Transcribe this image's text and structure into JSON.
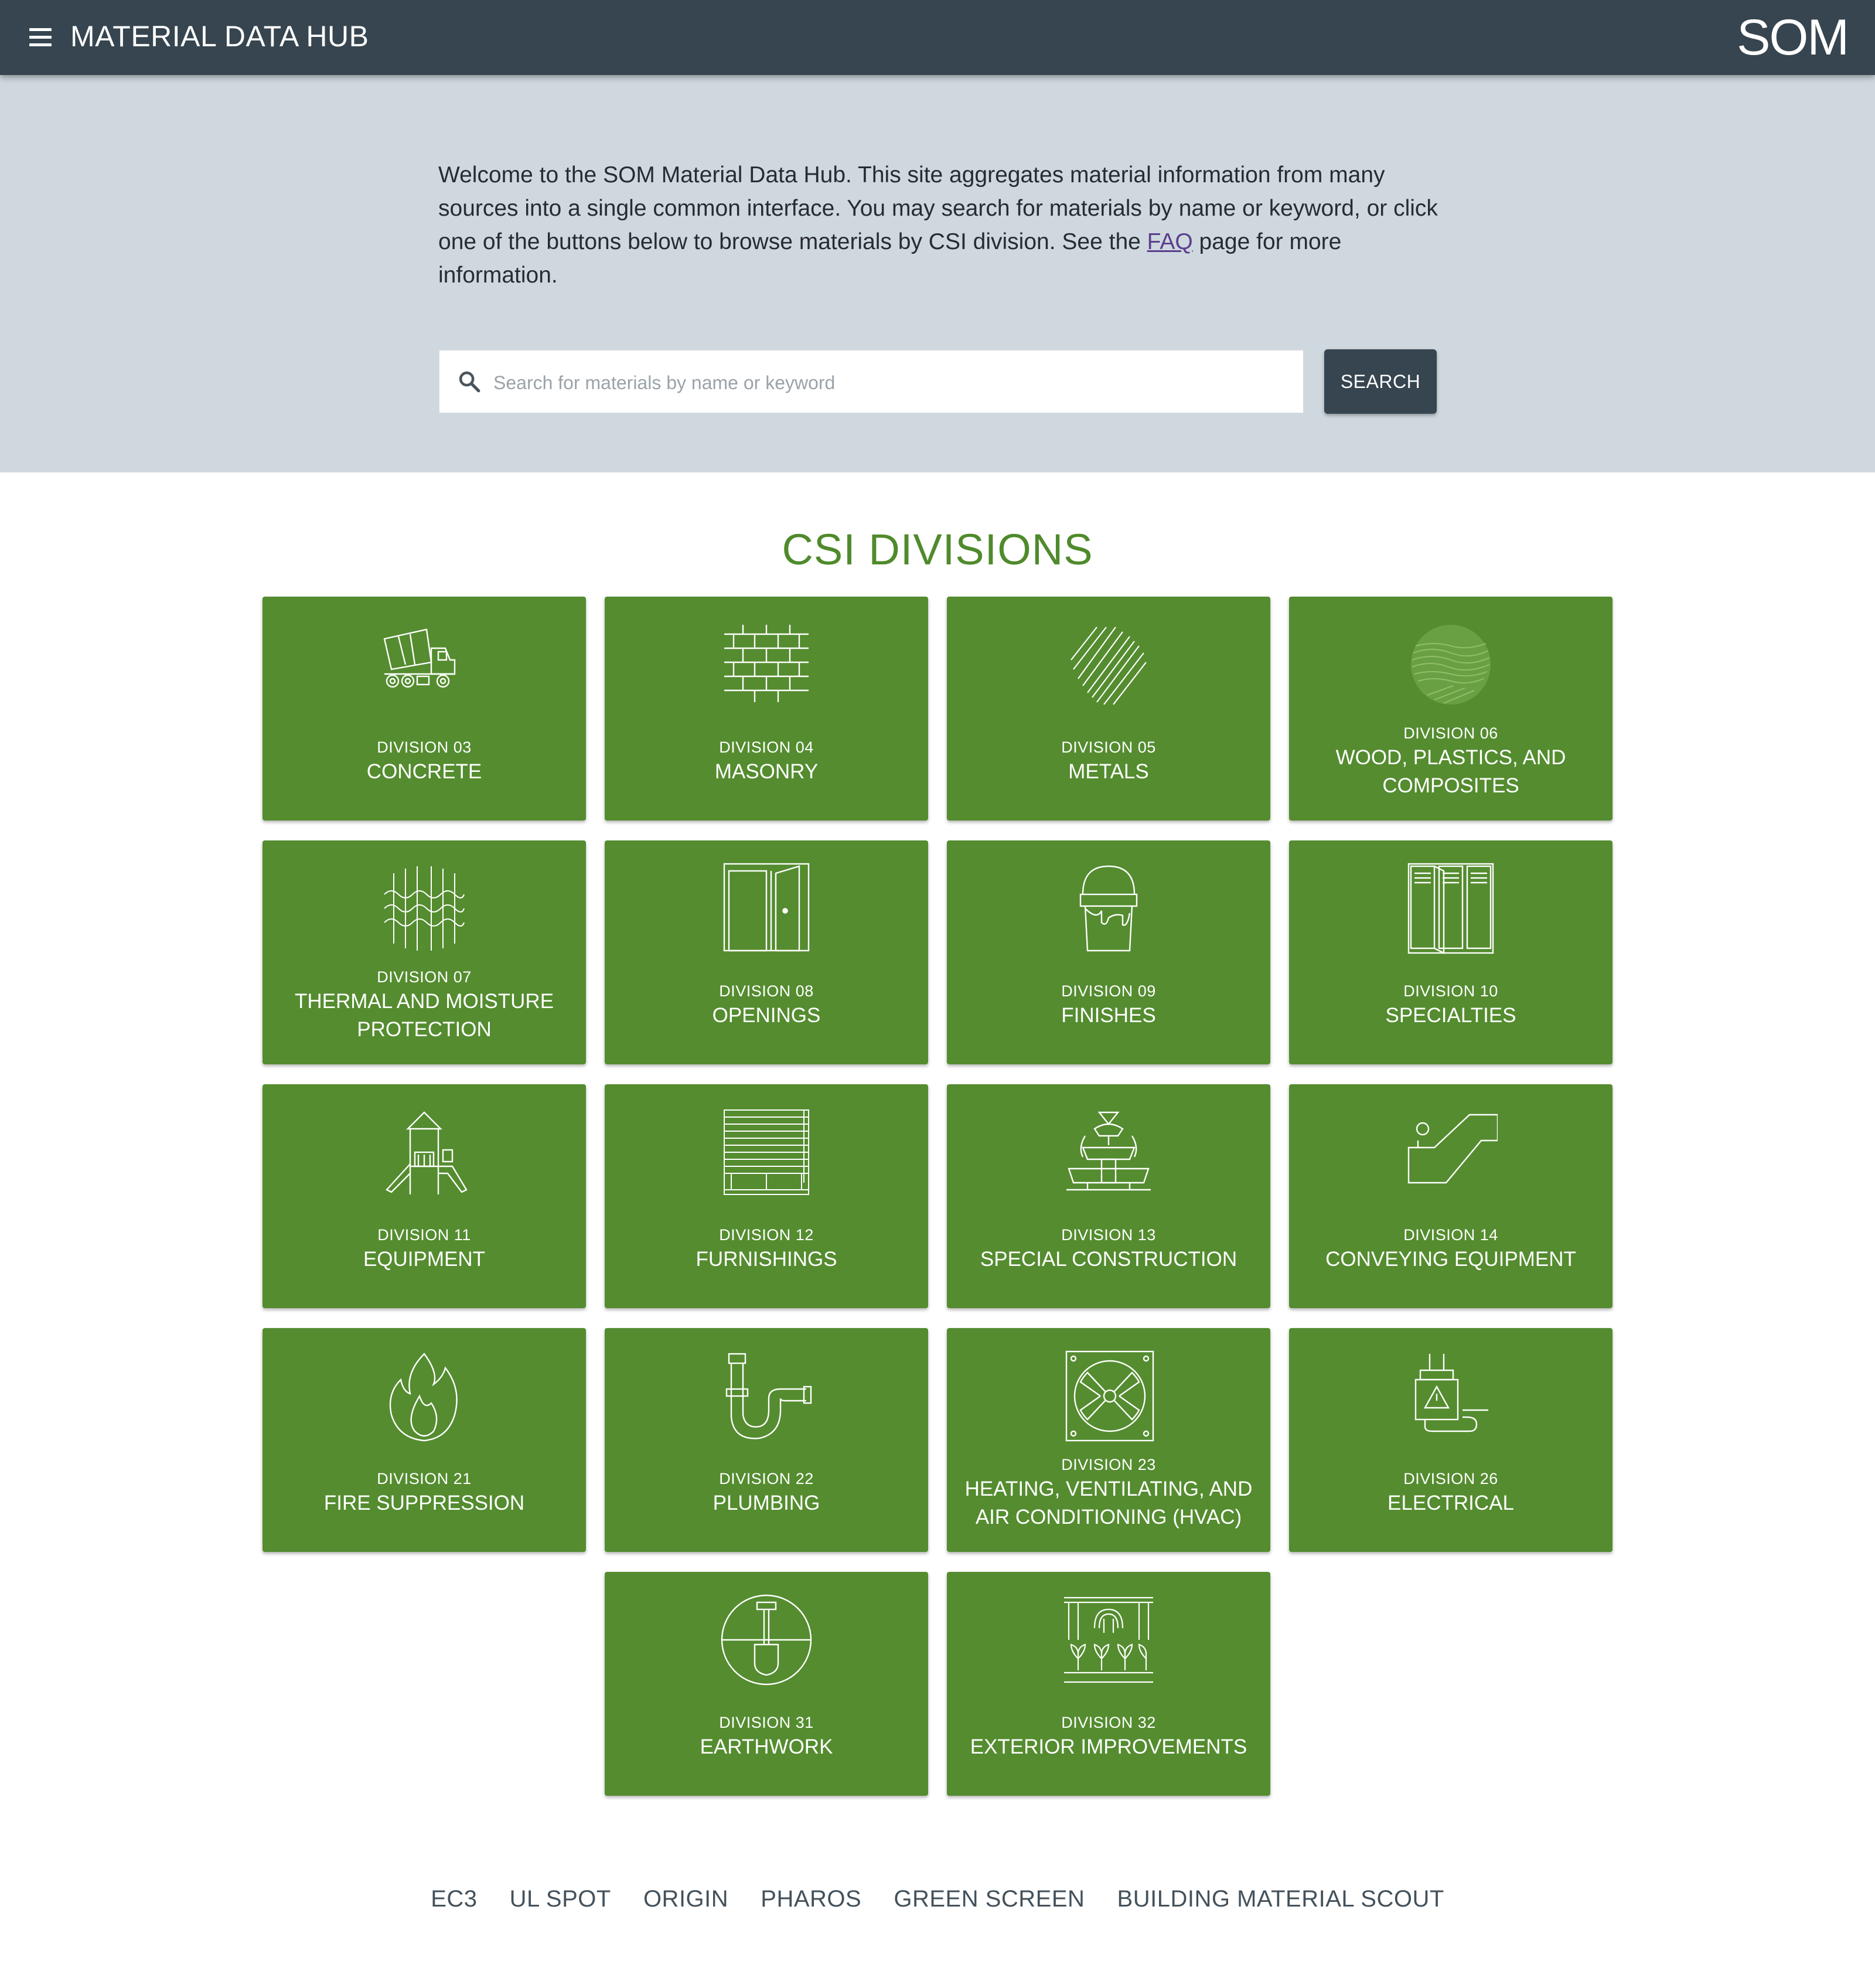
{
  "app": {
    "title": "MATERIAL DATA HUB",
    "logo": "SOM",
    "menu_icon": "hamburger-menu-icon"
  },
  "intro": {
    "before": "Welcome to the SOM Material Data Hub. This site aggregates material information from many sources into a single common interface. You may search for materials by name or keyword, or click one of the buttons below to browse materials by CSI division. See the ",
    "link": "FAQ",
    "after": " page for more information."
  },
  "search": {
    "placeholder": "Search for materials by name or keyword",
    "value": "",
    "button_label": "SEARCH"
  },
  "section_title": "CSI DIVISIONS",
  "divisions": [
    {
      "division": "DIVISION 03",
      "name": "CONCRETE",
      "icon": "concrete-mixer-truck-icon"
    },
    {
      "division": "DIVISION 04",
      "name": "MASONRY",
      "icon": "brick-wall-icon"
    },
    {
      "division": "DIVISION 05",
      "name": "METALS",
      "icon": "metal-texture-icon"
    },
    {
      "division": "DIVISION 06",
      "name": "WOOD, PLASTICS, AND COMPOSITES",
      "icon": "wood-grain-icon"
    },
    {
      "division": "DIVISION 07",
      "name": "THERMAL AND MOISTURE PROTECTION",
      "icon": "insulation-icon"
    },
    {
      "division": "DIVISION 08",
      "name": "OPENINGS",
      "icon": "door-icon"
    },
    {
      "division": "DIVISION 09",
      "name": "FINISHES",
      "icon": "paint-bucket-icon"
    },
    {
      "division": "DIVISION 10",
      "name": "SPECIALTIES",
      "icon": "lockers-icon"
    },
    {
      "division": "DIVISION 11",
      "name": "EQUIPMENT",
      "icon": "playground-icon"
    },
    {
      "division": "DIVISION 12",
      "name": "FURNISHINGS",
      "icon": "window-blinds-icon"
    },
    {
      "division": "DIVISION 13",
      "name": "SPECIAL CONSTRUCTION",
      "icon": "fountain-icon"
    },
    {
      "division": "DIVISION 14",
      "name": "CONVEYING EQUIPMENT",
      "icon": "escalator-icon"
    },
    {
      "division": "DIVISION 21",
      "name": "FIRE SUPPRESSION",
      "icon": "flame-icon"
    },
    {
      "division": "DIVISION 22",
      "name": "PLUMBING",
      "icon": "pipe-trap-icon"
    },
    {
      "division": "DIVISION 23",
      "name": "HEATING, VENTILATING, AND AIR CONDITIONING (HVAC)",
      "icon": "exhaust-fan-icon"
    },
    {
      "division": "DIVISION 26",
      "name": "ELECTRICAL",
      "icon": "electric-plug-icon"
    },
    {
      "division": "DIVISION 31",
      "name": "EARTHWORK",
      "icon": "shovel-icon"
    },
    {
      "division": "DIVISION 32",
      "name": "EXTERIOR IMPROVEMENTS",
      "icon": "planters-irrigation-icon"
    }
  ],
  "footer_links": [
    "EC3",
    "UL SPOT",
    "ORIGIN",
    "PHAROS",
    "GREEN SCREEN",
    "BUILDING MATERIAL SCOUT"
  ],
  "colors": {
    "appbar": "#36454f",
    "hero_background": "#cfd8de",
    "card_green": "#548c2f",
    "title_green": "#4f8a2c"
  }
}
